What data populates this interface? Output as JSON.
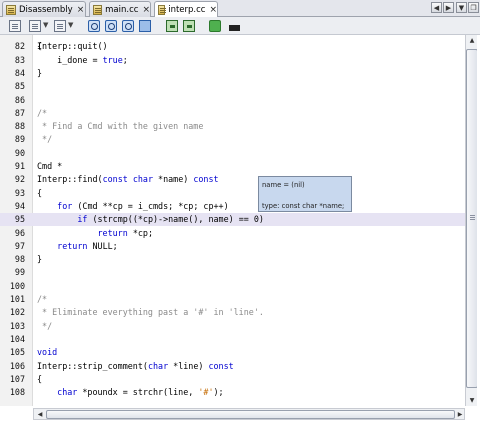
{
  "tabs": [
    {
      "label": "Disassembly",
      "active": false
    },
    {
      "label": "main.cc",
      "active": false
    },
    {
      "label": "interp.cc",
      "active": true
    }
  ],
  "tab_close_glyph": "×",
  "editor": {
    "lines": [
      {
        "num": "82",
        "text": "{",
        "kind": "plain"
      },
      {
        "num": "83",
        "text": "    i_done = true;",
        "kind": "plain"
      },
      {
        "num": "84",
        "text": "}",
        "kind": "plain"
      },
      {
        "num": "85",
        "text": "",
        "kind": "plain"
      },
      {
        "num": "86",
        "text": "",
        "kind": "plain"
      },
      {
        "num": "87",
        "text": "/*",
        "kind": "comment"
      },
      {
        "num": "88",
        "text": " * Find a Cmd with the given name",
        "kind": "comment"
      },
      {
        "num": "89",
        "text": " */",
        "kind": "comment"
      },
      {
        "num": "90",
        "text": "",
        "kind": "plain"
      },
      {
        "num": "91",
        "text": "Cmd *",
        "kind": "plain"
      },
      {
        "num": "92",
        "text": "Interp::find(const char *name) const",
        "kind": "plain"
      },
      {
        "num": "93",
        "text": "{",
        "kind": "plain"
      },
      {
        "num": "94",
        "text": "    for (Cmd **cp = i_cmds; *cp; cp++)",
        "kind": "plain"
      },
      {
        "num": "95",
        "text": "        if (strcmp((*cp)->name(), name) == 0)",
        "kind": "plain"
      },
      {
        "num": "96",
        "text": "            return *cp;",
        "kind": "plain"
      },
      {
        "num": "97",
        "text": "    return NULL;",
        "kind": "plain"
      },
      {
        "num": "98",
        "text": "}",
        "kind": "plain"
      },
      {
        "num": "99",
        "text": "",
        "kind": "plain"
      },
      {
        "num": "100",
        "text": "",
        "kind": "plain"
      },
      {
        "num": "101",
        "text": "/*",
        "kind": "comment"
      },
      {
        "num": "102",
        "text": " * Eliminate everything past a '#' in 'line'.",
        "kind": "comment"
      },
      {
        "num": "103",
        "text": " */",
        "kind": "comment"
      },
      {
        "num": "104",
        "text": "",
        "kind": "plain"
      },
      {
        "num": "105",
        "text": "void",
        "kind": "keyword"
      },
      {
        "num": "106",
        "text": "Interp::strip_comment(char *line) const",
        "kind": "plain"
      },
      {
        "num": "107",
        "text": "{",
        "kind": "plain"
      },
      {
        "num": "108",
        "text": "    char *poundx = strchr(line, '#');",
        "kind": "plain"
      }
    ],
    "partial_top_line": "Interp::quit()"
  },
  "tooltip": {
    "line1": "name = (nil)",
    "line2": "type: const char *name;"
  },
  "scrollbar": {
    "up_glyph": "▲",
    "down_glyph": "▼",
    "left_glyph": "◀",
    "right_glyph": "▶",
    "h_grip": "⁞"
  },
  "nav": {
    "left": "◀",
    "right": "▶",
    "menu": "▼",
    "restore": "❐"
  },
  "colors": {
    "keyword": "#0000d0",
    "comment": "#8a8a8a",
    "string": "#c46a00",
    "current_line": "#e6e3f3",
    "tooltip_bg": "#c8d8ee"
  }
}
